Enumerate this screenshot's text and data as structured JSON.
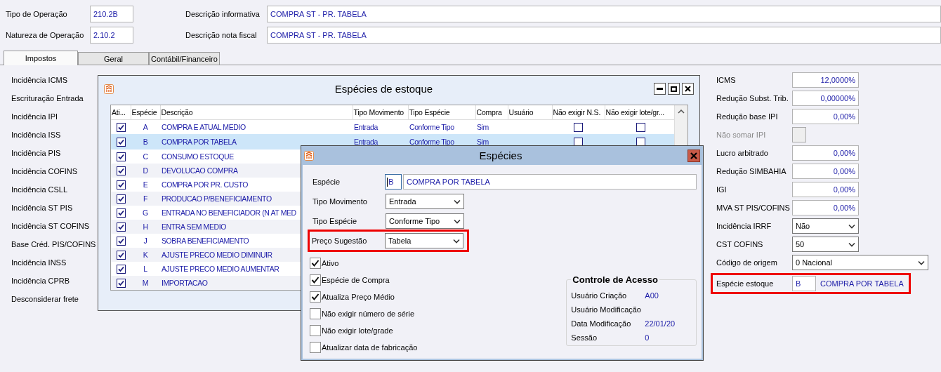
{
  "header": {
    "codes": [
      {
        "label": "Tipo de Operação",
        "value": "210.2B"
      },
      {
        "label": "Natureza de Operação",
        "value": "2.10.2"
      }
    ],
    "descriptions": [
      {
        "label": "Descrição informativa",
        "value": "COMPRA ST - PR. TABELA"
      },
      {
        "label": "Descrição nota fiscal",
        "value": "COMPRA ST - PR. TABELA"
      }
    ]
  },
  "tabs": [
    {
      "label": "Impostos",
      "selected": true
    },
    {
      "label": "Geral",
      "selected": false
    },
    {
      "label": "Contábil/Financeiro",
      "selected": false
    }
  ],
  "left_labels": [
    "Incidência ICMS",
    "Escrituração Entrada",
    "Incidência IPI",
    "Incidência ISS",
    "Incidência PIS",
    "Incidência COFINS",
    "Incidência CSLL",
    "Incidência ST PIS",
    "Incidência ST COFINS",
    "Base Créd. PIS/COFINS",
    "Incidência INSS",
    "Incidência CPRB",
    "Desconsiderar frete"
  ],
  "right_fields": [
    {
      "kind": "number",
      "label": "ICMS",
      "value": "12,0000%"
    },
    {
      "kind": "number",
      "label": "Redução Subst. Trib.",
      "value": "0,00000%"
    },
    {
      "kind": "number",
      "label": "Redução base IPI",
      "value": "0,00%"
    },
    {
      "kind": "checkbox",
      "label": "Não somar IPI",
      "checked": false,
      "disabled": true
    },
    {
      "kind": "number",
      "label": "Lucro arbitrado",
      "value": "0,00%"
    },
    {
      "kind": "number",
      "label": "Redução SIMBAHIA",
      "value": "0,00%"
    },
    {
      "kind": "number",
      "label": "IGI",
      "value": "0,00%"
    },
    {
      "kind": "number",
      "label": "MVA ST PIS/COFINS",
      "value": "0,00%"
    },
    {
      "kind": "select",
      "label": "Incidência IRRF",
      "value": "Não"
    },
    {
      "kind": "select",
      "label": "CST COFINS",
      "value": "50"
    },
    {
      "kind": "select-wide",
      "label": "Código de origem",
      "value": "0 Nacional"
    },
    {
      "kind": "lookup",
      "label": "Espécie estoque",
      "value": "B",
      "description": "COMPRA POR TABELA",
      "highlighted": true
    }
  ],
  "stock_window": {
    "title": "Espécies de estoque",
    "columns": [
      "Ati...",
      "Espécie",
      "Descrição",
      "Tipo Movimento",
      "Tipo Espécie",
      "Compra",
      "Usuário",
      "Não exigir N.S.",
      "Não exigir lote/gr..."
    ],
    "rows": [
      {
        "ativo": true,
        "especie": "A",
        "descricao": "COMPRA E ATUAL MEDIO",
        "tipo_movimento": "Entrada",
        "tipo_especie": "Conforme Tipo",
        "compra": "Sim",
        "nao_exigir_ns": false,
        "nao_exigir_lote": false,
        "selected": false
      },
      {
        "ativo": true,
        "especie": "B",
        "descricao": "COMPRA POR TABELA",
        "tipo_movimento": "Entrada",
        "tipo_especie": "Conforme Tipo",
        "compra": "Sim",
        "nao_exigir_ns": false,
        "nao_exigir_lote": false,
        "selected": true
      },
      {
        "ativo": true,
        "especie": "C",
        "descricao": "CONSUMO ESTOQUE",
        "selected": false
      },
      {
        "ativo": true,
        "especie": "D",
        "descricao": "DEVOLUCAO COMPRA",
        "selected": false
      },
      {
        "ativo": true,
        "especie": "E",
        "descricao": "COMPRA POR PR. CUSTO",
        "selected": false
      },
      {
        "ativo": true,
        "especie": "F",
        "descricao": "PRODUCAO P/BENEFICIAMENTO",
        "selected": false
      },
      {
        "ativo": true,
        "especie": "G",
        "descricao": "ENTRADA NO BENEFICIADOR (N AT MED",
        "selected": false
      },
      {
        "ativo": true,
        "especie": "H",
        "descricao": "ENTRA SEM MEDIO",
        "selected": false
      },
      {
        "ativo": true,
        "especie": "J",
        "descricao": "SOBRA BENEFICIAMENTO",
        "selected": false
      },
      {
        "ativo": true,
        "especie": "K",
        "descricao": "AJUSTE PRECO MEDIO DIMINUIR",
        "selected": false
      },
      {
        "ativo": true,
        "especie": "L",
        "descricao": "AJUSTE PRECO MEDIO AUMENTAR",
        "selected": false
      },
      {
        "ativo": true,
        "especie": "M",
        "descricao": "IMPORTACAO",
        "selected": false
      }
    ]
  },
  "dialog": {
    "title": "Espécies",
    "especie": {
      "label": "Espécie",
      "code": "B",
      "description": "COMPRA POR TABELA"
    },
    "selects": [
      {
        "label": "Tipo Movimento",
        "value": "Entrada",
        "highlighted": false
      },
      {
        "label": "Tipo Espécie",
        "value": "Conforme Tipo",
        "highlighted": false
      },
      {
        "label": "Preço Sugestão",
        "value": "Tabela",
        "highlighted": true
      }
    ],
    "checks": [
      {
        "label": "Ativo",
        "checked": true
      },
      {
        "label": "Espécie de Compra",
        "checked": true
      },
      {
        "label": "Atualiza Preço Médio",
        "checked": true
      },
      {
        "label": "Não exigir número de série",
        "checked": false
      },
      {
        "label": "Não exigir lote/grade",
        "checked": false
      },
      {
        "label": "Atualizar data de fabricação",
        "checked": false
      }
    ],
    "access": {
      "title": "Controle de Acesso",
      "rows": [
        {
          "label": "Usuário Criação",
          "value": "A00"
        },
        {
          "label": "Usuário Modificação"
        },
        {
          "label": "Data Modificação",
          "value": "22/01/20"
        },
        {
          "label": "Sessão",
          "value": "0"
        }
      ]
    }
  }
}
